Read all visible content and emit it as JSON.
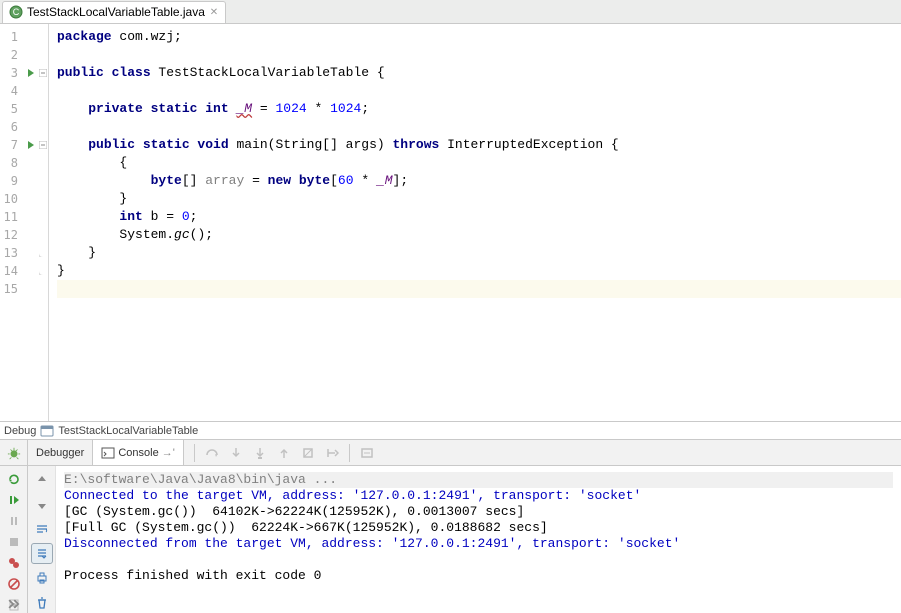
{
  "tab": {
    "filename": "TestStackLocalVariableTable.java",
    "close_tooltip": "Close"
  },
  "code_lines": [
    {
      "n": 1,
      "run": false,
      "fold": "",
      "html": "<span class='kw'>package</span> com.wzj;"
    },
    {
      "n": 2,
      "run": false,
      "fold": "",
      "html": ""
    },
    {
      "n": 3,
      "run": true,
      "fold": "open",
      "html": "<span class='kw'>public class</span> TestStackLocalVariableTable {"
    },
    {
      "n": 4,
      "run": false,
      "fold": "",
      "html": ""
    },
    {
      "n": 5,
      "run": false,
      "fold": "",
      "html": "    <span class='kw'>private static int</span> <span class='it-pur und-red'>_M</span> = <span class='nums'>1024</span> * <span class='nums'>1024</span>;"
    },
    {
      "n": 6,
      "run": false,
      "fold": "",
      "html": ""
    },
    {
      "n": 7,
      "run": true,
      "fold": "open",
      "html": "    <span class='kw'>public static void</span> main(String[] args) <span class='kw'>throws</span> InterruptedException {"
    },
    {
      "n": 8,
      "run": false,
      "fold": "",
      "html": "        {"
    },
    {
      "n": 9,
      "run": false,
      "fold": "",
      "html": "            <span class='kw'>byte</span>[] <span class='gray'>array</span> = <span class='kw'>new byte</span>[<span class='nums'>60</span> * <span class='it-pur'>_M</span>];"
    },
    {
      "n": 10,
      "run": false,
      "fold": "",
      "html": "        }"
    },
    {
      "n": 11,
      "run": false,
      "fold": "",
      "html": "        <span class='kw'>int</span> b = <span class='nums'>0</span>;"
    },
    {
      "n": 12,
      "run": false,
      "fold": "",
      "html": "        System.<span class='it'>gc</span>();"
    },
    {
      "n": 13,
      "run": false,
      "fold": "close",
      "html": "    }"
    },
    {
      "n": 14,
      "run": false,
      "fold": "close",
      "html": "}"
    },
    {
      "n": 15,
      "run": false,
      "fold": "",
      "html": "",
      "current": true
    }
  ],
  "debug_label": {
    "prefix": "Debug",
    "config": "TestStackLocalVariableTable"
  },
  "run_tabs": {
    "debugger": "Debugger",
    "console": "Console",
    "arrow": "→'"
  },
  "console_lines": [
    {
      "cls": "c-gray",
      "text": "E:\\software\\Java\\Java8\\bin\\java ..."
    },
    {
      "cls": "c-blue",
      "text": "Connected to the target VM, address: '127.0.0.1:2491', transport: 'socket'"
    },
    {
      "cls": "",
      "text": "[GC (System.gc())  64102K->62224K(125952K), 0.0013007 secs]"
    },
    {
      "cls": "",
      "text": "[Full GC (System.gc())  62224K->667K(125952K), 0.0188682 secs]"
    },
    {
      "cls": "c-blue",
      "text": "Disconnected from the target VM, address: '127.0.0.1:2491', transport: 'socket'"
    },
    {
      "cls": "",
      "text": ""
    },
    {
      "cls": "",
      "text": "Process finished with exit code 0"
    }
  ],
  "icons": {
    "run_green": "▶"
  }
}
